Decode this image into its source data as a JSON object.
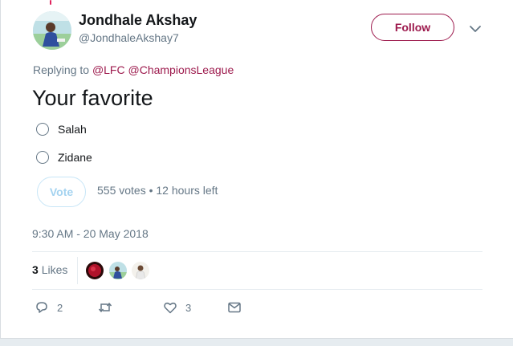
{
  "author": {
    "name": "Jondhale Akshay",
    "handle": "@JondhaleAkshay7"
  },
  "follow_label": "Follow",
  "reply": {
    "prefix": "Replying to",
    "mentions": [
      "@LFC",
      "@ChampionsLeague"
    ]
  },
  "tweet_text": "Your favorite",
  "poll": {
    "options": [
      "Salah",
      "Zidane"
    ],
    "vote_label": "Vote",
    "meta": "555 votes • 12 hours left"
  },
  "timestamp": "9:30 AM - 20 May 2018",
  "likes": {
    "count": "3",
    "label": "Likes"
  },
  "actions": {
    "reply_count": "2",
    "retweet_count": "",
    "like_count": "3"
  },
  "colors": {
    "accent": "#9d1a4d",
    "muted": "#657786",
    "vote_light": "#a4d3f0"
  },
  "icons": {
    "menu": "chevron-down-icon",
    "reply": "reply-icon",
    "retweet": "retweet-icon",
    "like": "heart-icon",
    "message": "envelope-icon"
  }
}
